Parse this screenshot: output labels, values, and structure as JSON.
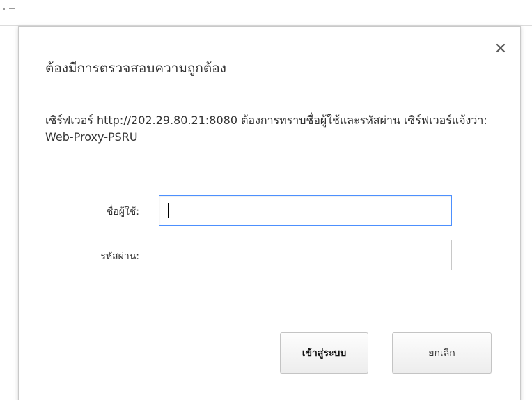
{
  "dialog": {
    "title": "ต้องมีการตรวจสอบความถูกต้อง",
    "close_label": "×",
    "message": "เซิร์ฟเวอร์ http://202.29.80.21:8080 ต้องการทราบชื่อผู้ใช้และรหัสผ่าน เซิร์ฟเวอร์แจ้งว่า: Web-Proxy-PSRU",
    "username": {
      "label": "ชื่อผู้ใช้:",
      "value": "",
      "placeholder": ""
    },
    "password": {
      "label": "รหัสผ่าน:",
      "value": "",
      "placeholder": ""
    },
    "buttons": {
      "login": "เข้าสู่ระบบ",
      "cancel": "ยกเลิก"
    }
  },
  "icons": {
    "close": "close-icon"
  },
  "colors": {
    "focus_border": "#4d90fe",
    "text": "#333333",
    "border": "#c8c8c8"
  }
}
